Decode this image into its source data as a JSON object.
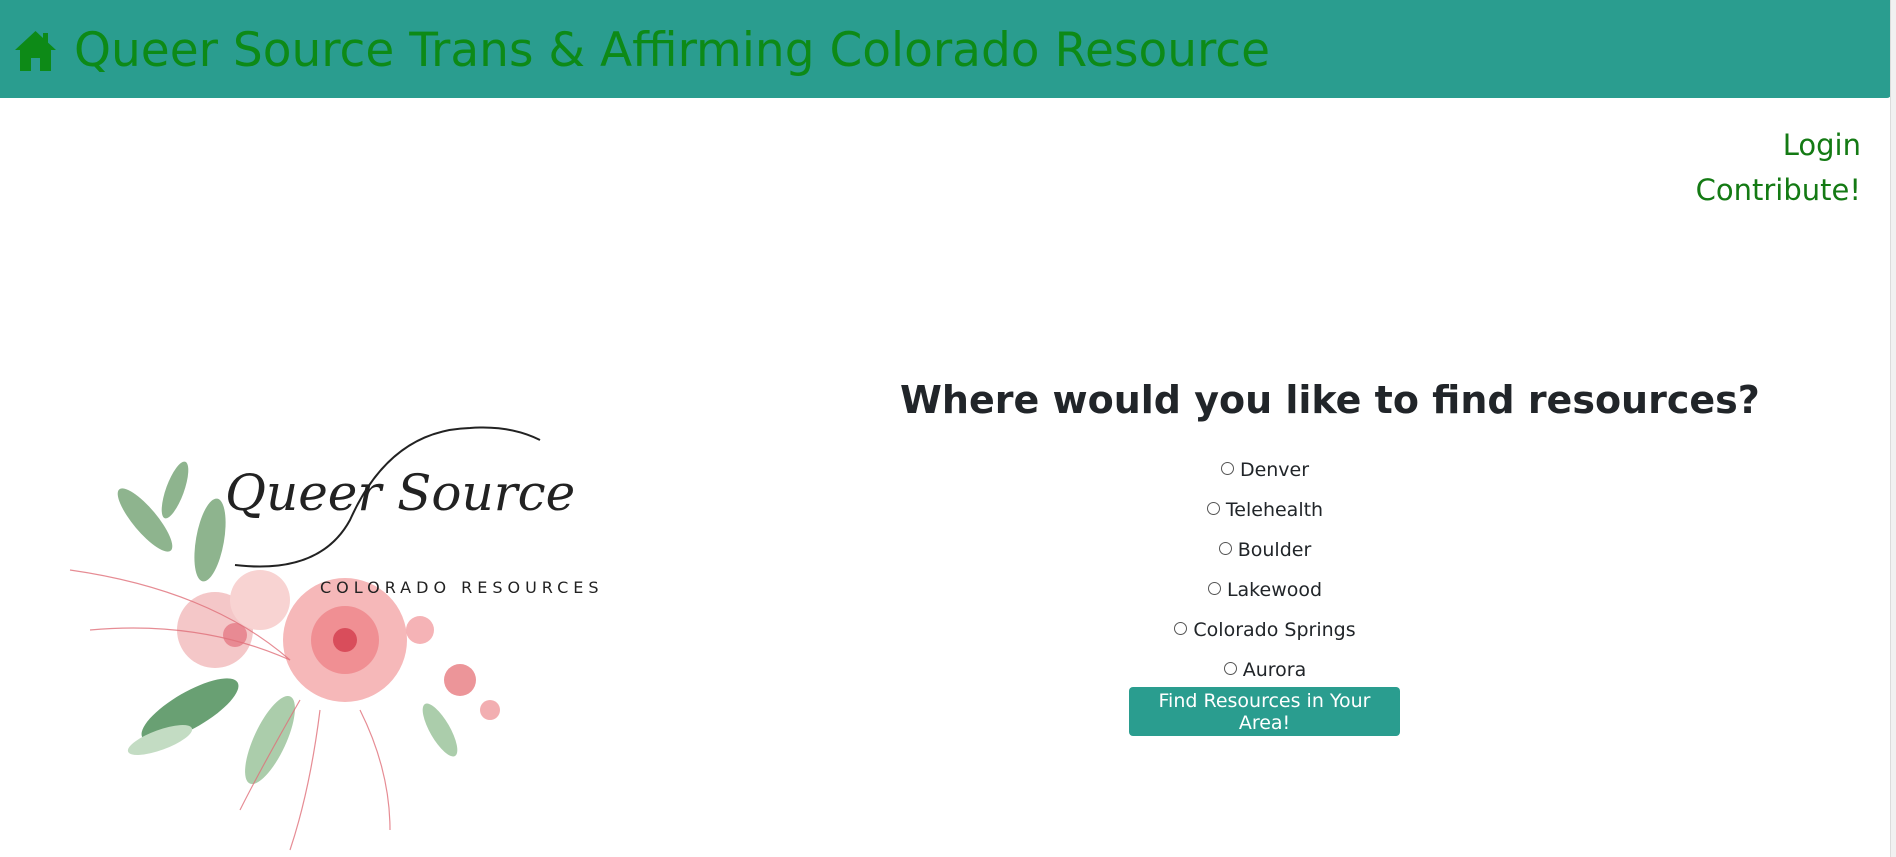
{
  "header": {
    "title": "Queer Source Trans & Affirming Colorado Resource",
    "home_icon": "home-icon",
    "background": "#2a9d8f",
    "title_color": "#0d8a17"
  },
  "nav": {
    "login": "Login",
    "contribute": "Contribute!"
  },
  "logo": {
    "script_text": "Queer Source",
    "subtitle": "COLORADO RESOURCES"
  },
  "search": {
    "question": "Where would you like to find resources?",
    "options": [
      "Denver",
      "Telehealth",
      "Boulder",
      "Lakewood",
      "Colorado Springs",
      "Aurora"
    ],
    "button": "Find Resources in Your Area!"
  }
}
